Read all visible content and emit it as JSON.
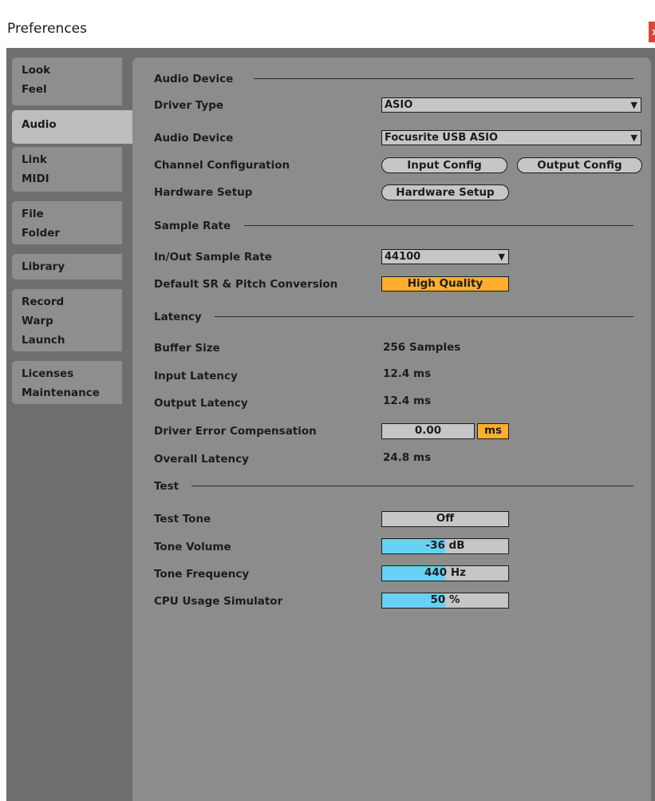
{
  "window": {
    "title": "Preferences",
    "close_label": "x"
  },
  "sidebar": {
    "tabs": [
      {
        "lines": [
          "Look",
          "Feel"
        ]
      },
      {
        "lines": [
          "Audio"
        ],
        "active": true
      },
      {
        "lines": [
          "Link",
          "MIDI"
        ]
      },
      {
        "lines": [
          "File",
          "Folder"
        ]
      },
      {
        "lines": [
          "Library"
        ]
      },
      {
        "lines": [
          "Record",
          "Warp",
          "Launch"
        ]
      },
      {
        "lines": [
          "Licenses",
          "Maintenance"
        ]
      }
    ]
  },
  "audio_device": {
    "title": "Audio Device",
    "driver_type_label": "Driver Type",
    "driver_type_value": "ASIO",
    "audio_device_label": "Audio Device",
    "audio_device_value": "Focusrite USB ASIO",
    "channel_config_label": "Channel Configuration",
    "input_config_button": "Input Config",
    "output_config_button": "Output Config",
    "hardware_setup_label": "Hardware Setup",
    "hardware_setup_button": "Hardware Setup"
  },
  "sample_rate": {
    "title": "Sample Rate",
    "in_out_label": "In/Out Sample Rate",
    "in_out_value": "44100",
    "conversion_label": "Default SR & Pitch Conversion",
    "conversion_value": "High Quality"
  },
  "latency": {
    "title": "Latency",
    "buffer_size_label": "Buffer Size",
    "buffer_size_value": "256 Samples",
    "input_latency_label": "Input Latency",
    "input_latency_value": "12.4 ms",
    "output_latency_label": "Output Latency",
    "output_latency_value": "12.4 ms",
    "driver_error_label": "Driver Error Compensation",
    "driver_error_value": "0.00",
    "driver_error_unit": "ms",
    "overall_latency_label": "Overall Latency",
    "overall_latency_value": "24.8 ms"
  },
  "test": {
    "title": "Test",
    "test_tone_label": "Test Tone",
    "test_tone_value": "Off",
    "tone_volume_label": "Tone Volume",
    "tone_volume_value": "-36 dB",
    "tone_volume_fill": 0.5,
    "tone_frequency_label": "Tone Frequency",
    "tone_frequency_value": "440 Hz",
    "tone_frequency_fill": 0.5,
    "cpu_usage_label": "CPU Usage Simulator",
    "cpu_usage_value": "50 %",
    "cpu_usage_fill": 0.5
  },
  "colors": {
    "accent_orange": "#ffae2f",
    "slider_fill": "#67d2f6",
    "panel": "#8c8c8c",
    "background": "#6e6e6e"
  }
}
